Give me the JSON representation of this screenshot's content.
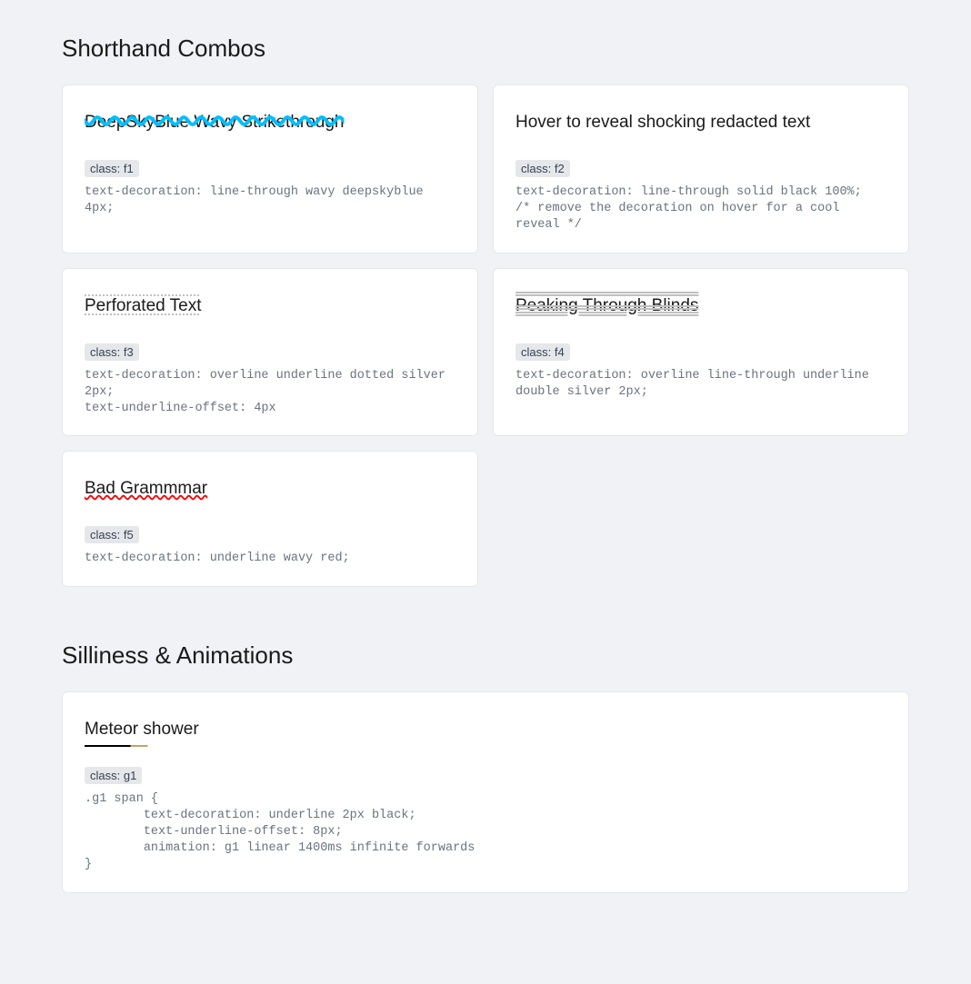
{
  "sections": {
    "shorthand": {
      "title": "Shorthand Combos",
      "cards": [
        {
          "demo": "DeepSkyBlue Wavy Strikethrough",
          "tag": "class: f1",
          "css": "text-decoration: line-through wavy deepskyblue 4px;"
        },
        {
          "demo": "Hover to reveal shocking redacted text",
          "tag": "class: f2",
          "css": "text-decoration: line-through solid black 100%;\n/* remove the decoration on hover for a cool reveal */"
        },
        {
          "demo": "Perforated Text",
          "tag": "class: f3",
          "css": "text-decoration: overline underline dotted silver 2px;\ntext-underline-offset: 4px"
        },
        {
          "demo": "Peaking Through Blinds",
          "tag": "class: f4",
          "css": "text-decoration: overline line-through underline double silver 2px;"
        },
        {
          "demo": "Bad Grammmar",
          "tag": "class: f5",
          "css": "text-decoration: underline wavy red;"
        }
      ]
    },
    "silliness": {
      "title": "Silliness & Animations",
      "cards": [
        {
          "demo": "Meteor shower",
          "tag": "class: g1",
          "css": ".g1 span {\n        text-decoration: underline 2px black;\n        text-underline-offset: 8px;\n        animation: g1 linear 1400ms infinite forwards\n}"
        }
      ]
    }
  }
}
